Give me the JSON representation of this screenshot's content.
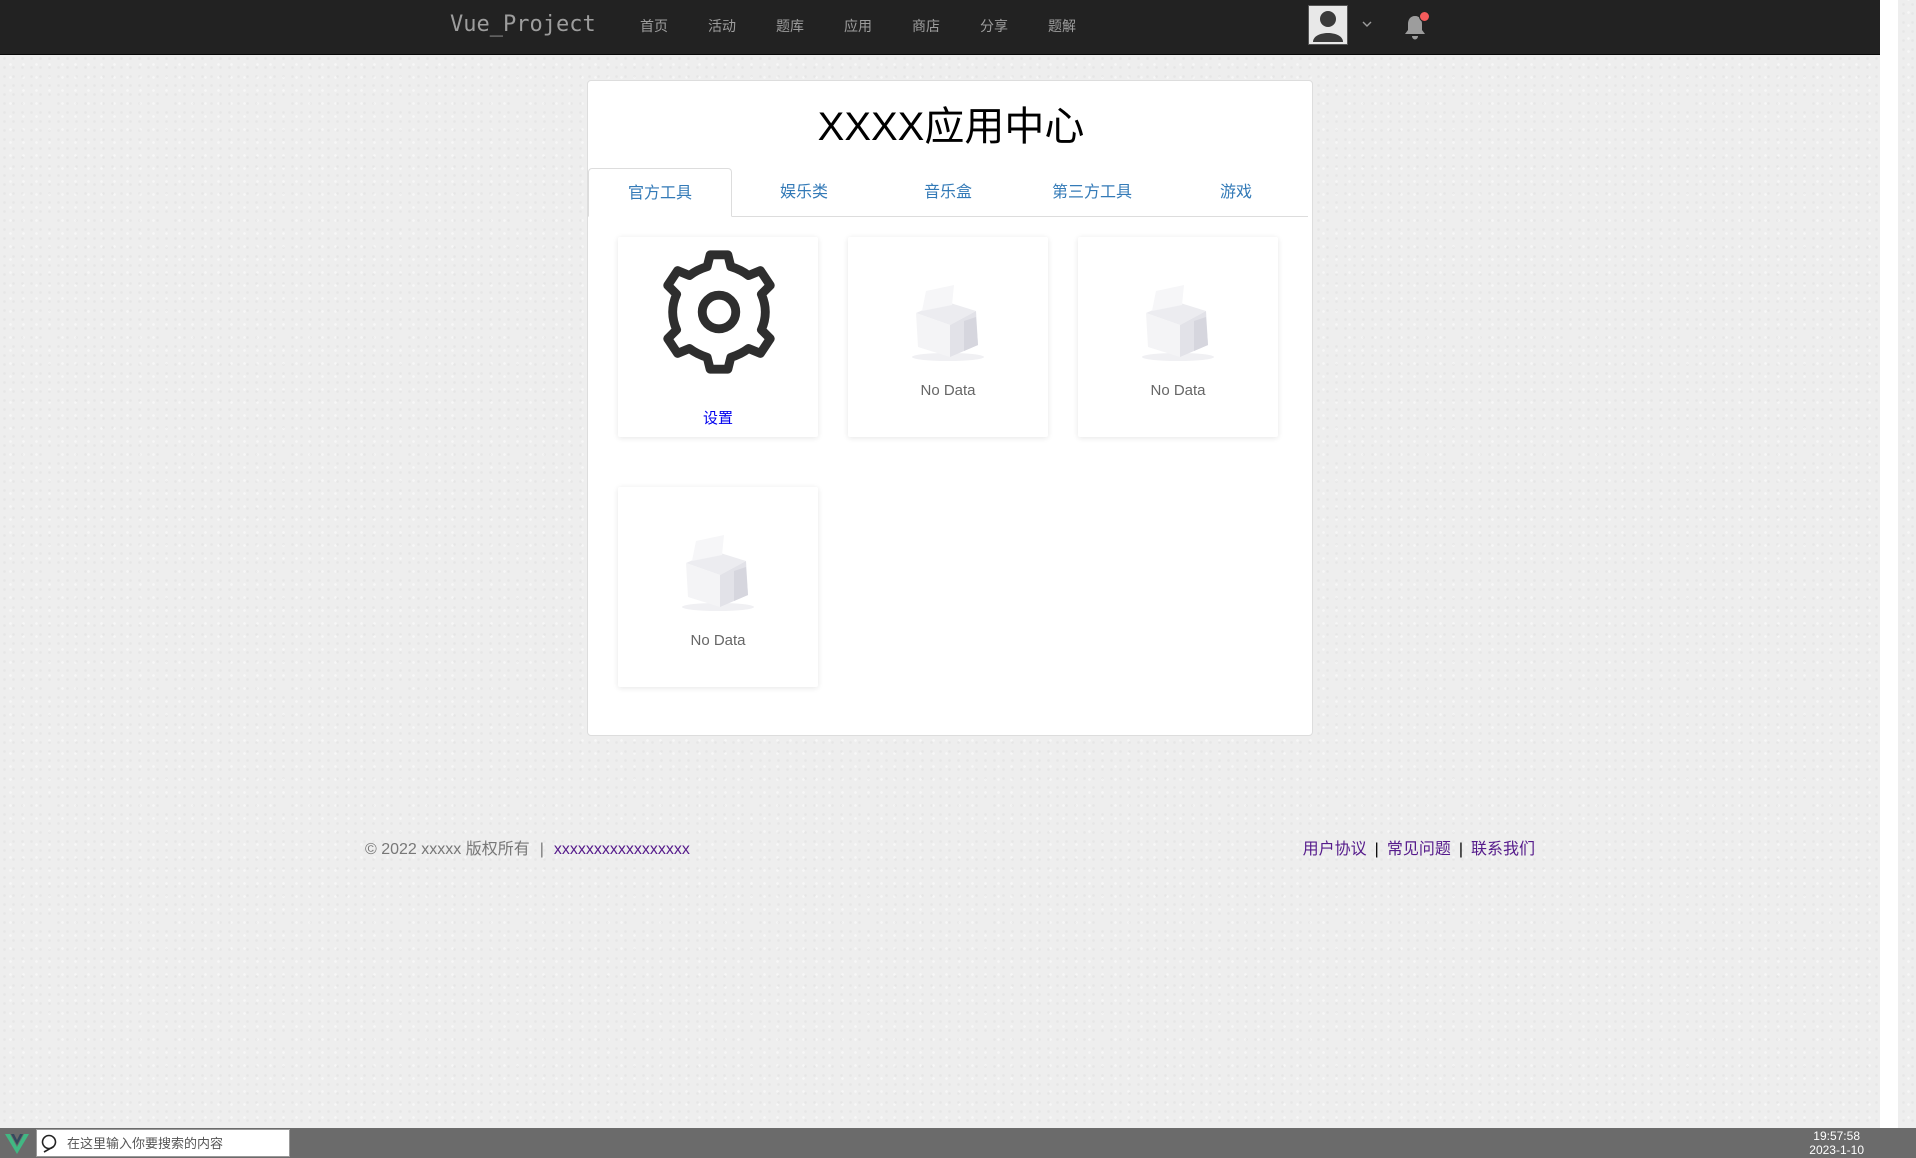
{
  "navbar": {
    "brand": "Vue_Project",
    "links": [
      "首页",
      "活动",
      "题库",
      "应用",
      "商店",
      "分享",
      "题解"
    ]
  },
  "card": {
    "title": "XXXX应用中心",
    "tabs": [
      "官方工具",
      "娱乐类",
      "音乐盒",
      "第三方工具",
      "游戏"
    ],
    "active_tab": "官方工具",
    "tiles": [
      {
        "icon": "gear-icon",
        "label": "设置"
      },
      {
        "icon": "empty-box-icon",
        "label": "No Data"
      },
      {
        "icon": "empty-box-icon",
        "label": "No Data"
      },
      {
        "icon": "empty-box-icon",
        "label": "No Data"
      }
    ]
  },
  "footer": {
    "copyright": "© 2022 xxxxx 版权所有",
    "copyright_link": "xxxxxxxxxxxxxxxxx",
    "links": [
      "用户协议",
      "常见问题",
      "联系我们"
    ],
    "separator": "|"
  },
  "taskbar": {
    "search_placeholder": "在这里输入你要搜索的内容",
    "time": "19:57:58",
    "date": "2023-1-10"
  },
  "colors": {
    "navbar_bg": "#222222",
    "nav_text": "#9d9d9d",
    "tab_text": "#337ab7",
    "notification_dot": "#f45b5b",
    "tile_label": "#0000ee",
    "footer_link": "#551a8b"
  }
}
